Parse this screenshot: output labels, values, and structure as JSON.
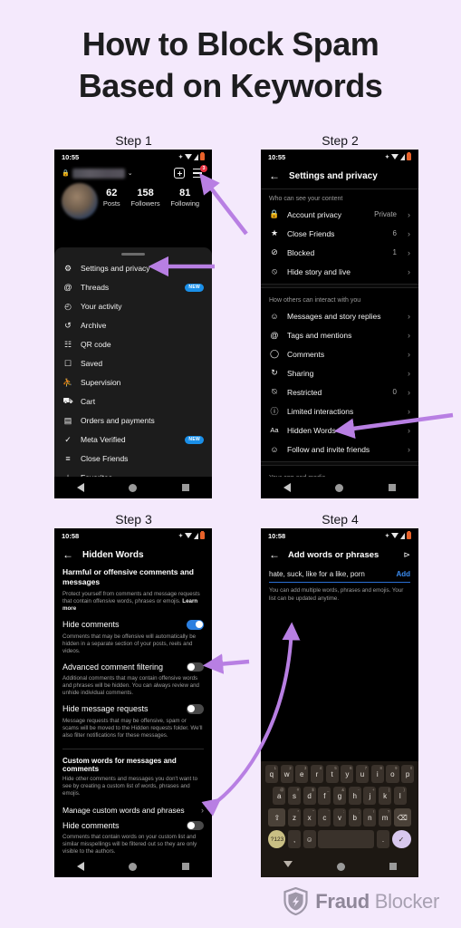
{
  "page": {
    "title_line1": "How to Block Spam",
    "title_line2": "Based on Keywords",
    "background_color": "#f4e9fc",
    "arrow_color": "#b87fe3"
  },
  "steps": [
    {
      "label": "Step 1"
    },
    {
      "label": "Step 2"
    },
    {
      "label": "Step 3"
    },
    {
      "label": "Step 4"
    }
  ],
  "phone1": {
    "status": {
      "time": "10:55",
      "icons": [
        "bluetooth-icon",
        "wifi-icon",
        "signal-icon",
        "battery-icon"
      ]
    },
    "profile": {
      "username_blurred": true,
      "display_name_blurred": true,
      "stats": [
        {
          "number": "62",
          "label": "Posts"
        },
        {
          "number": "158",
          "label": "Followers"
        },
        {
          "number": "81",
          "label": "Following"
        }
      ]
    },
    "notification_badge": "3",
    "menu": [
      {
        "icon": "gear-icon",
        "label": "Settings and privacy",
        "badge": ""
      },
      {
        "icon": "threads-icon",
        "label": "Threads",
        "badge": "NEW"
      },
      {
        "icon": "clock-icon",
        "label": "Your activity",
        "badge": ""
      },
      {
        "icon": "archive-icon",
        "label": "Archive",
        "badge": ""
      },
      {
        "icon": "qr-code-icon",
        "label": "QR code",
        "badge": ""
      },
      {
        "icon": "bookmark-icon",
        "label": "Saved",
        "badge": ""
      },
      {
        "icon": "supervision-icon",
        "label": "Supervision",
        "badge": ""
      },
      {
        "icon": "cart-icon",
        "label": "Cart",
        "badge": ""
      },
      {
        "icon": "card-icon",
        "label": "Orders and payments",
        "badge": ""
      },
      {
        "icon": "verified-icon",
        "label": "Meta Verified",
        "badge": "NEW"
      },
      {
        "icon": "list-icon",
        "label": "Close Friends",
        "badge": ""
      },
      {
        "icon": "star-icon",
        "label": "Favorites",
        "badge": ""
      }
    ]
  },
  "phone2": {
    "status": {
      "time": "10:55"
    },
    "header_title": "Settings and privacy",
    "section1_title": "Who can see your content",
    "section1_rows": [
      {
        "icon": "lock-icon",
        "label": "Account privacy",
        "value": "Private"
      },
      {
        "icon": "close-friends-icon",
        "label": "Close Friends",
        "value": "6"
      },
      {
        "icon": "blocked-icon",
        "label": "Blocked",
        "value": "1"
      },
      {
        "icon": "hide-story-icon",
        "label": "Hide story and live",
        "value": ""
      }
    ],
    "section2_title": "How others can interact with you",
    "section2_rows": [
      {
        "icon": "message-icon",
        "label": "Messages and story replies",
        "value": ""
      },
      {
        "icon": "tag-icon",
        "label": "Tags and mentions",
        "value": ""
      },
      {
        "icon": "comment-icon",
        "label": "Comments",
        "value": ""
      },
      {
        "icon": "share-icon",
        "label": "Sharing",
        "value": ""
      },
      {
        "icon": "restricted-icon",
        "label": "Restricted",
        "value": "0"
      },
      {
        "icon": "limited-icon",
        "label": "Limited interactions",
        "value": ""
      },
      {
        "icon": "hidden-words-icon",
        "label": "Hidden Words",
        "value": ""
      },
      {
        "icon": "follow-invite-icon",
        "label": "Follow and invite friends",
        "value": ""
      }
    ],
    "section3_title": "Your app and media"
  },
  "phone3": {
    "status": {
      "time": "10:58"
    },
    "header_title": "Hidden Words",
    "heading1": "Harmful or offensive comments and messages",
    "desc1": "Protect yourself from comments and message requests that contain offensive words, phrases or emojis. ",
    "desc1_link": "Learn more",
    "toggle1": {
      "label": "Hide comments",
      "state": "on"
    },
    "desc2": "Comments that may be offensive will automatically be hidden in a separate section of your posts, reels and videos.",
    "toggle2": {
      "label": "Advanced comment filtering",
      "state": "off"
    },
    "desc3": "Additional comments that may contain offensive words and phrases will be hidden. You can always review and unhide individual comments.",
    "toggle3": {
      "label": "Hide message requests",
      "state": "off"
    },
    "desc4": "Message requests that may be offensive, spam or scams will be moved to the Hidden requests folder. We'll also filter notifications for these messages.",
    "heading2": "Custom words for messages and comments",
    "desc5": "Hide other comments and messages you don't want to see by creating a custom list of words, phrases and emojis.",
    "link_row": "Manage custom words and phrases",
    "toggle4": {
      "label": "Hide comments",
      "state": "off"
    },
    "desc6": "Comments that contain words on your custom list and similar misspellings will be filtered out so they are only visible to the authors."
  },
  "phone4": {
    "status": {
      "time": "10:58"
    },
    "header_title": "Add words or phrases",
    "share_icon": "share-icon",
    "input_value": "hate, suck, like for a like, porn",
    "add_label": "Add",
    "hint": "You can add multiple words, phrases and emojis. Your list can be updated anytime.",
    "keyboard": {
      "row1": [
        {
          "k": "q",
          "n": "1"
        },
        {
          "k": "w",
          "n": "2"
        },
        {
          "k": "e",
          "n": "3"
        },
        {
          "k": "r",
          "n": "4"
        },
        {
          "k": "t",
          "n": "5"
        },
        {
          "k": "y",
          "n": "6"
        },
        {
          "k": "u",
          "n": "7"
        },
        {
          "k": "i",
          "n": "8"
        },
        {
          "k": "o",
          "n": "9"
        },
        {
          "k": "p",
          "n": "0"
        }
      ],
      "row2": [
        {
          "k": "a",
          "n": "@"
        },
        {
          "k": "s",
          "n": "#"
        },
        {
          "k": "d",
          "n": "$"
        },
        {
          "k": "f",
          "n": "_"
        },
        {
          "k": "g",
          "n": "&"
        },
        {
          "k": "h",
          "n": "-"
        },
        {
          "k": "j",
          "n": "+"
        },
        {
          "k": "k",
          "n": "("
        },
        {
          "k": "l",
          "n": ")"
        }
      ],
      "row3": [
        {
          "k": "z",
          "n": "*"
        },
        {
          "k": "x",
          "n": "\""
        },
        {
          "k": "c",
          "n": "'"
        },
        {
          "k": "v",
          "n": ":"
        },
        {
          "k": "b",
          "n": ";"
        },
        {
          "k": "n",
          "n": "!"
        },
        {
          "k": "m",
          "n": "?"
        }
      ],
      "shift": "⇧",
      "backspace": "⌫",
      "numeric": "?123",
      "comma": ",",
      "emoji": "☺",
      "period": ".",
      "enter": "✓"
    }
  },
  "footer": {
    "logo_icon": "shield-icon",
    "brand_bold": "Fraud",
    "brand_light": "Blocker"
  }
}
